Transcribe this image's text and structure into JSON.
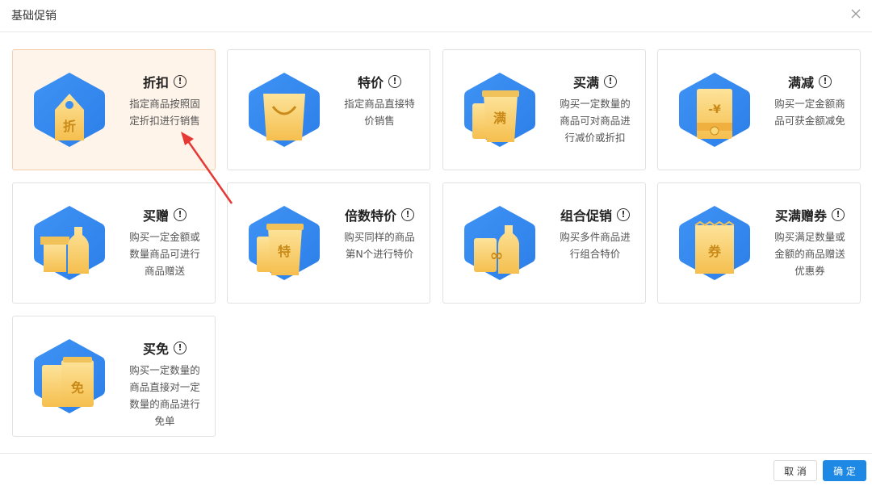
{
  "dialog": {
    "title": "基础促销"
  },
  "colors": {
    "selected_bg": "#fff4ea",
    "primary": "#1e88e5",
    "annotation_arrow": "#e53935"
  },
  "cards": [
    {
      "name": "折扣",
      "desc": [
        "指定商品按照固",
        "定折扣进行销售"
      ],
      "glyph": "折",
      "icon": "tag-icon",
      "selected": true
    },
    {
      "name": "特价",
      "desc": [
        "指定商品直接特",
        "价销售"
      ],
      "glyph": "",
      "icon": "shopping-bag-icon",
      "selected": false
    },
    {
      "name": "买满",
      "desc": [
        "购买一定数量的",
        "商品可对商品进",
        "行减价或折扣"
      ],
      "glyph": "满",
      "icon": "cups-icon",
      "selected": false
    },
    {
      "name": "满减",
      "desc": [
        "购买一定金额商",
        "品可获金额减免"
      ],
      "glyph": "-¥",
      "icon": "money-envelope-icon",
      "selected": false
    },
    {
      "name": "买赠",
      "desc": [
        "购买一定金额或",
        "数量商品可进行",
        "商品赠送"
      ],
      "glyph": "",
      "icon": "gift-bottle-icon",
      "selected": false
    },
    {
      "name": "倍数特价",
      "desc": [
        "购买同样的商品",
        "第N个进行特价"
      ],
      "glyph": "特",
      "icon": "cups-icon",
      "selected": false
    },
    {
      "name": "组合促销",
      "desc": [
        "购买多件商品进",
        "行组合特价"
      ],
      "glyph": "∞",
      "icon": "bottles-combo-icon",
      "selected": false
    },
    {
      "name": "买满赠券",
      "desc": [
        "购买满足数量或",
        "金额的商品赠送",
        "优惠券"
      ],
      "glyph": "券",
      "icon": "coupon-icon",
      "selected": false
    },
    {
      "name": "买免",
      "desc": [
        "购买一定数量的",
        "商品直接对一定",
        "数量的商品进行",
        "免单"
      ],
      "glyph": "免",
      "icon": "free-bags-icon",
      "selected": false
    }
  ],
  "footer": {
    "cancel": "取 消",
    "ok": "确 定"
  },
  "info_glyph": "!"
}
